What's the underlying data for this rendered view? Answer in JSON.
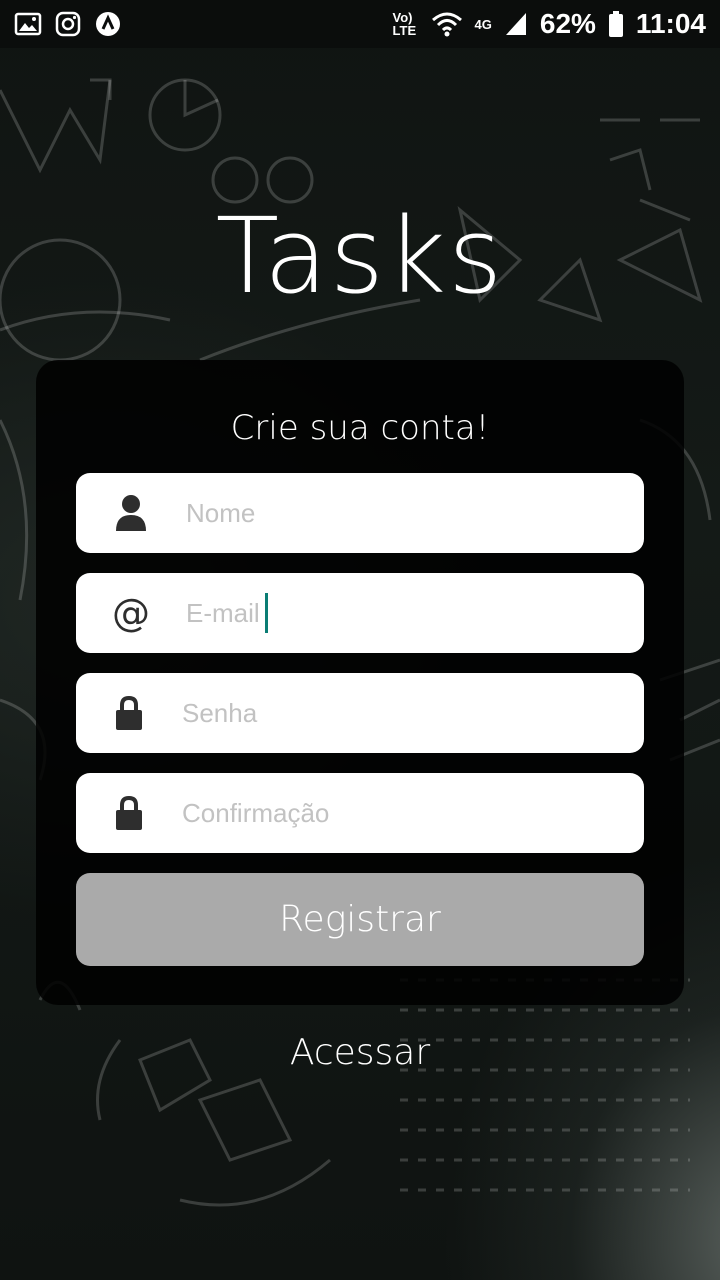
{
  "status_bar": {
    "left_icons": [
      "gallery-icon",
      "instagram-icon",
      "app-icon"
    ],
    "network_label": "Vo) LTE",
    "network_type": "4G",
    "battery": "62%",
    "time": "11:04"
  },
  "app": {
    "title": "Tasks"
  },
  "form": {
    "heading": "Crie sua conta!",
    "fields": {
      "name": {
        "placeholder": "Nome",
        "icon": "user-icon"
      },
      "email": {
        "placeholder": "E-mail",
        "icon": "at-icon"
      },
      "password": {
        "placeholder": "Senha",
        "icon": "lock-icon"
      },
      "confirm": {
        "placeholder": "Confirmação",
        "icon": "lock-icon"
      }
    },
    "submit_label": "Registrar"
  },
  "footer": {
    "login_link": "Acessar"
  },
  "colors": {
    "card_bg": "#000000",
    "button_bg": "#aaaaaa",
    "cursor": "#0a7d74",
    "placeholder": "#c2c2c2"
  }
}
